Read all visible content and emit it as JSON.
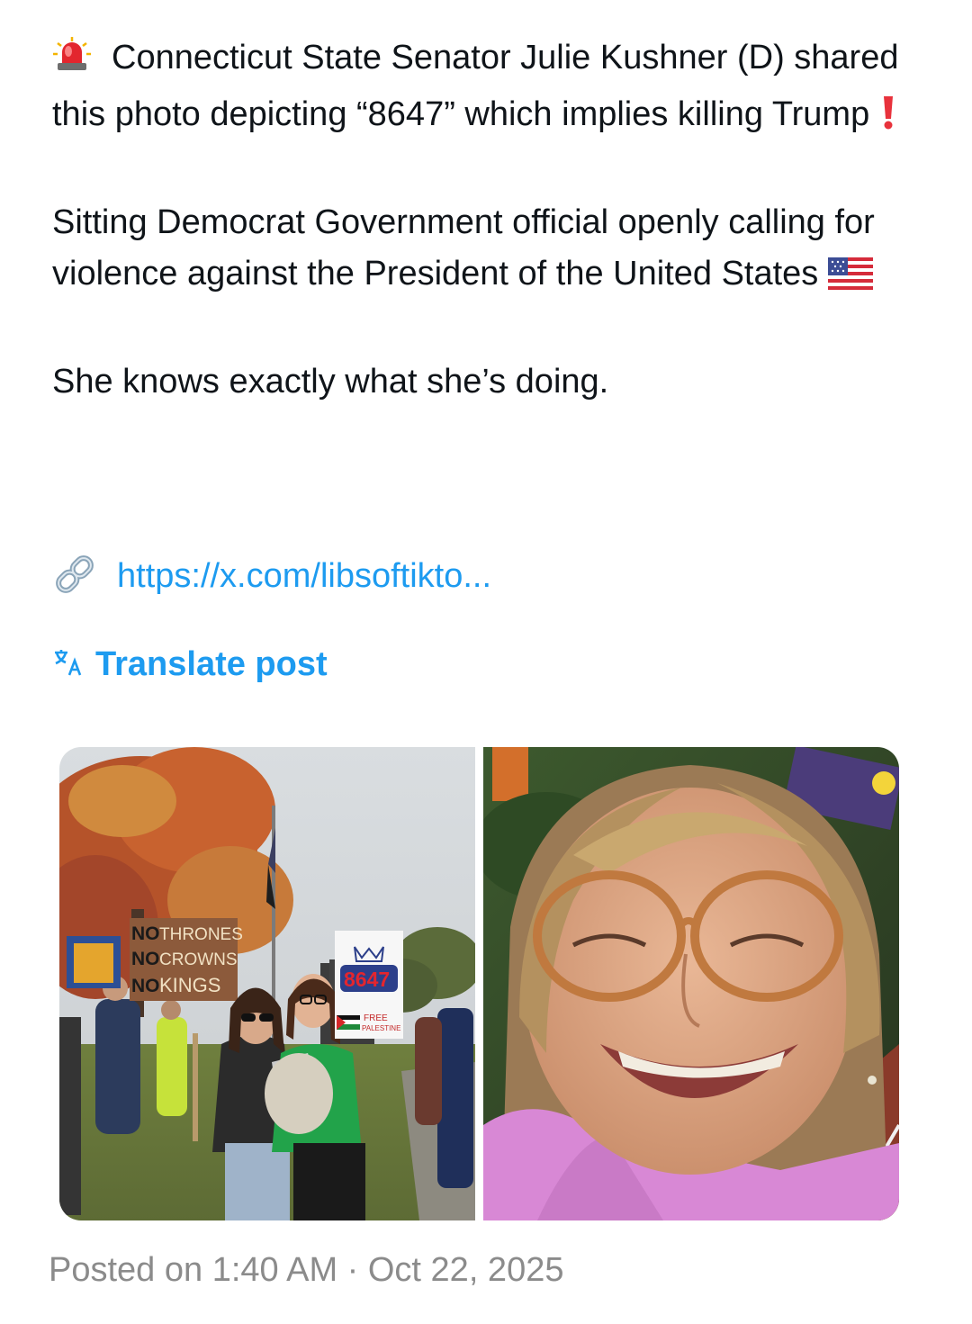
{
  "post": {
    "line1": "Connecticut State Senator Julie Kushner (D) shared this photo depicting “8647” which implies killing Trump",
    "line2": "Sitting Democrat Government official openly calling for violence against the President of the United States",
    "line3": "She knows exactly what she’s doing.",
    "siren_icon": "police-light-emoji",
    "exclamation_icon": "red-exclamation-emoji",
    "flag_icon": "us-flag-emoji"
  },
  "link": {
    "icon": "link-icon",
    "text": "https://x.com/libsoftikto..."
  },
  "translate": {
    "icon": "translate-icon",
    "label": "Translate post"
  },
  "media": {
    "left_signs": {
      "no1": "NO",
      "thrones": "THRONES",
      "no2": "NO",
      "crowns": "CROWNS",
      "no3": "NO",
      "kings": "KINGS",
      "code": "8647",
      "free": "FREE",
      "palestine": "PALESTINE"
    }
  },
  "timestamp": "Posted on 1:40 AM · Oct 22, 2025",
  "colors": {
    "link": "#1d9bf0",
    "text": "#0f1419",
    "muted": "#8b8b8b"
  }
}
